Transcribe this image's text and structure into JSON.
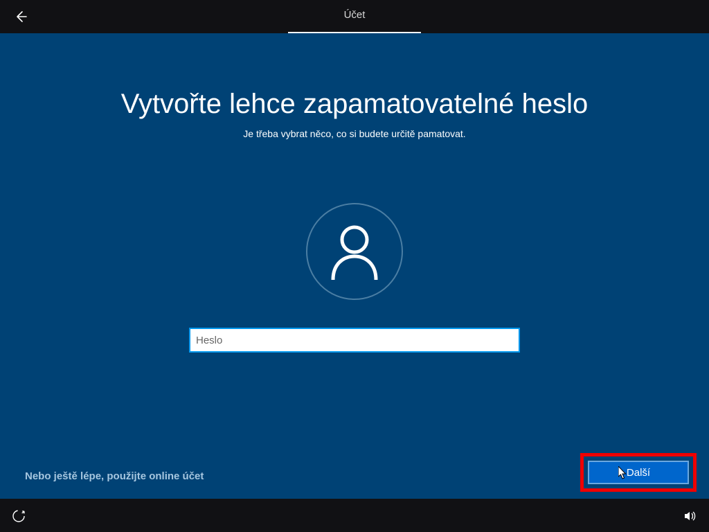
{
  "titlebar": {
    "tab_label": "Účet"
  },
  "main": {
    "heading": "Vytvořte lehce zapamatovatelné heslo",
    "subtitle": "Je třeba vybrat něco, co si budete určitě pamatovat.",
    "password_placeholder": "Heslo",
    "online_link": "Nebo ještě lépe, použijte online účet",
    "next_label": "Další"
  }
}
